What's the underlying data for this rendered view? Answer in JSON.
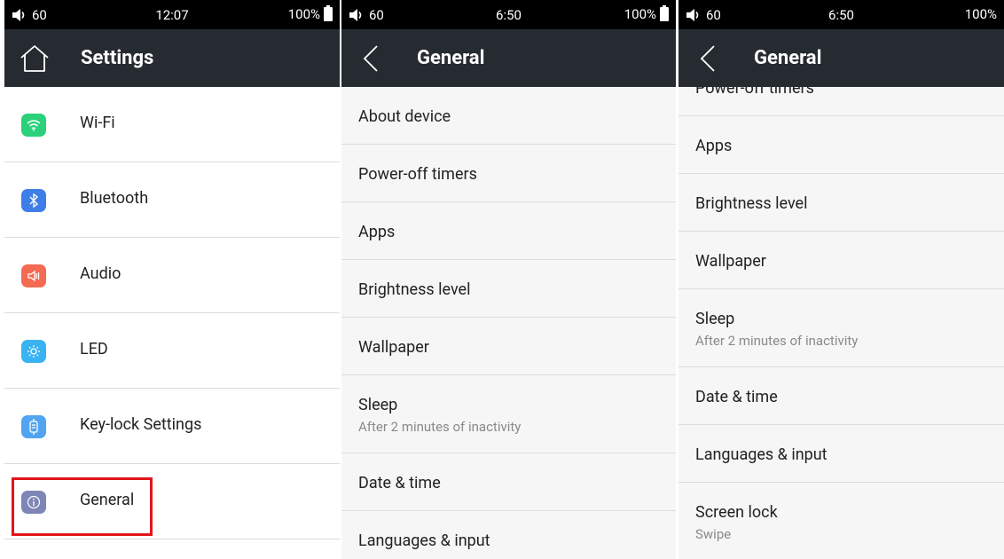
{
  "screen1": {
    "status": {
      "volume": "60",
      "time": "12:07",
      "battery": "100%"
    },
    "title": "Settings",
    "items": [
      {
        "label": "Wi-Fi",
        "icon": "wifi-icon",
        "color": "#2bd07a"
      },
      {
        "label": "Bluetooth",
        "icon": "bluetooth-icon",
        "color": "#3f7ee8"
      },
      {
        "label": "Audio",
        "icon": "speaker-icon",
        "color": "#f46a52"
      },
      {
        "label": "LED",
        "icon": "sun-icon",
        "color": "#3ab3f2"
      },
      {
        "label": "Key-lock Settings",
        "icon": "key-lock-icon",
        "color": "#52a4f0"
      },
      {
        "label": "General",
        "icon": "info-icon",
        "color": "#7d86b6"
      }
    ]
  },
  "screen2": {
    "status": {
      "volume": "60",
      "time": "6:50",
      "battery": "100%"
    },
    "title": "General",
    "items": [
      {
        "label": "About device"
      },
      {
        "label": "Power-off timers"
      },
      {
        "label": "Apps"
      },
      {
        "label": "Brightness level"
      },
      {
        "label": "Wallpaper"
      },
      {
        "label": "Sleep",
        "sub": "After 2 minutes of inactivity"
      },
      {
        "label": "Date & time"
      },
      {
        "label": "Languages & input"
      }
    ]
  },
  "screen3": {
    "status": {
      "volume": "60",
      "time": "6:50",
      "battery": "100%"
    },
    "title": "General",
    "items": [
      {
        "label": "Power-off timers"
      },
      {
        "label": "Apps"
      },
      {
        "label": "Brightness level"
      },
      {
        "label": "Wallpaper"
      },
      {
        "label": "Sleep",
        "sub": "After 2 minutes of inactivity"
      },
      {
        "label": "Date & time"
      },
      {
        "label": "Languages & input"
      },
      {
        "label": "Screen lock",
        "sub": "Swipe"
      }
    ]
  },
  "accent_colors": {
    "appbar": "#262b31",
    "highlight": "#e3141a"
  }
}
